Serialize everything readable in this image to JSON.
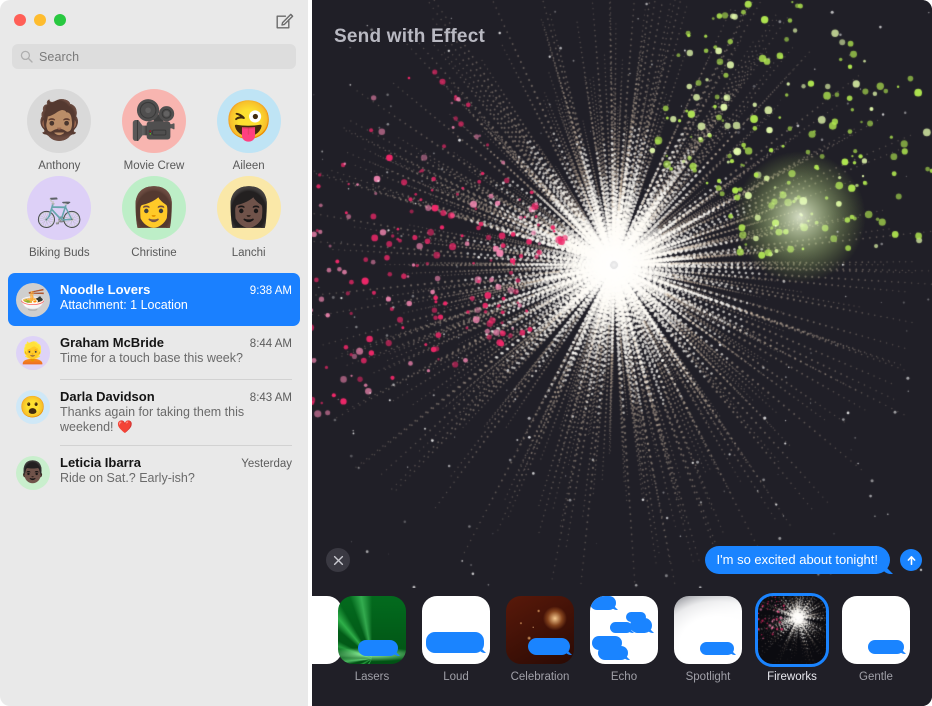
{
  "window": {
    "traffic_lights": [
      "close",
      "minimize",
      "zoom"
    ],
    "compose_icon": "compose-icon"
  },
  "sidebar": {
    "search": {
      "placeholder": "Search",
      "value": "",
      "icon": "search-icon"
    },
    "pinned": [
      {
        "label": "Anthony",
        "glyph": "🧔🏽",
        "bg": "#d9d9d9"
      },
      {
        "label": "Movie Crew",
        "glyph": "🎥",
        "bg": "#f8b5b0"
      },
      {
        "label": "Aileen",
        "glyph": "😜",
        "bg": "#bfe4f5"
      },
      {
        "label": "Biking Buds",
        "glyph": "🚲",
        "bg": "#ddd0f7"
      },
      {
        "label": "Christine",
        "glyph": "👩",
        "bg": "#bdeec7"
      },
      {
        "label": "Lanchi",
        "glyph": "👩🏿",
        "bg": "#fae8a8"
      }
    ],
    "conversations": [
      {
        "name": "Noodle Lovers",
        "time": "9:38 AM",
        "preview": "Attachment: 1 Location",
        "glyph": "🍜",
        "bg": "#cfcfcf",
        "selected": true
      },
      {
        "name": "Graham McBride",
        "time": "8:44 AM",
        "preview": "Time for a touch base this week?",
        "glyph": "👱",
        "bg": "#ded3f7",
        "selected": false
      },
      {
        "name": "Darla Davidson",
        "time": "8:43 AM",
        "preview": "Thanks again for taking them this weekend! ❤️",
        "glyph": "😮",
        "bg": "#cfe8f7",
        "selected": false
      },
      {
        "name": "Leticia Ibarra",
        "time": "Yesterday",
        "preview": "Ride on Sat.? Early-ish?",
        "glyph": "👨🏿",
        "bg": "#c9efcd",
        "selected": false
      }
    ]
  },
  "main": {
    "title": "Send with Effect",
    "close_button_icon": "close-icon",
    "send_button_icon": "arrow-up-icon",
    "message": {
      "text": "I'm so excited about tonight!",
      "bubble_color": "#1a84ff"
    },
    "preview_effect": "Fireworks",
    "effects": [
      {
        "label": "",
        "style": "bg-white",
        "partial": true,
        "selected": false
      },
      {
        "label": "Lasers",
        "style": "bg-lasers",
        "partial": false,
        "selected": false
      },
      {
        "label": "Loud",
        "style": "bg-white",
        "partial": false,
        "selected": false
      },
      {
        "label": "Celebration",
        "style": "bg-celebration",
        "partial": false,
        "selected": false
      },
      {
        "label": "Echo",
        "style": "bg-white",
        "partial": false,
        "selected": false
      },
      {
        "label": "Spotlight",
        "style": "bg-spotlight",
        "partial": false,
        "selected": false
      },
      {
        "label": "Fireworks",
        "style": "bg-fireworks-thumb",
        "partial": false,
        "selected": true
      },
      {
        "label": "Gentle",
        "style": "bg-white",
        "partial": false,
        "selected": false
      }
    ],
    "colors": {
      "panel_bg": "#201f27",
      "accent": "#1a84ff",
      "title_text": "#b9b9c2"
    }
  }
}
